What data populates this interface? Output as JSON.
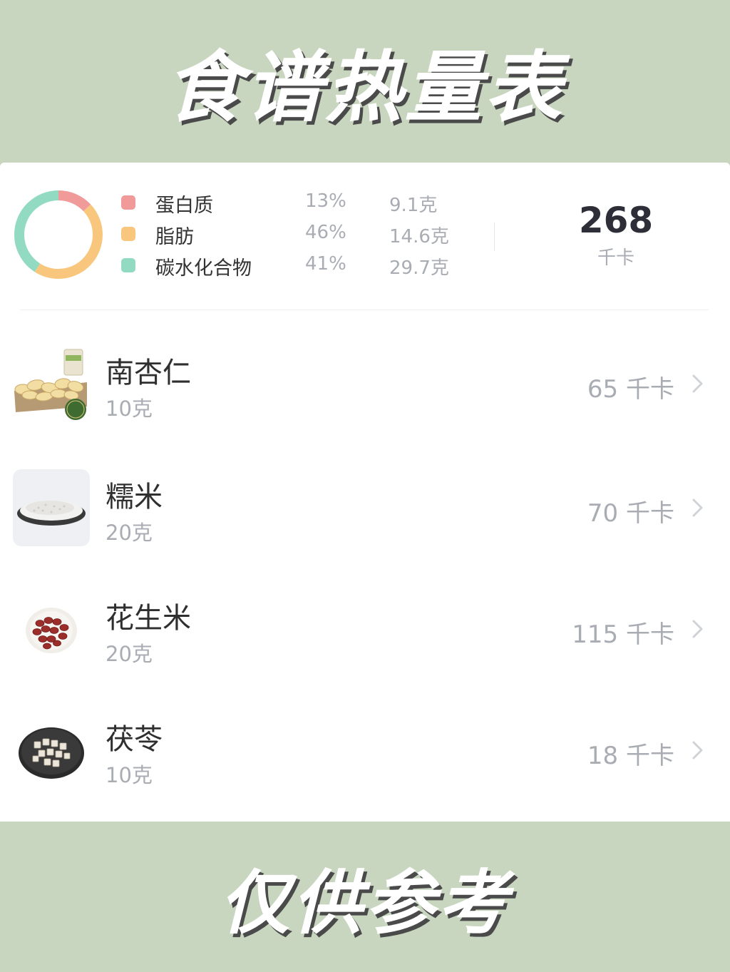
{
  "header": {
    "title": "食谱热量表"
  },
  "footer": {
    "title": "仅供参考"
  },
  "nutrition": {
    "items": [
      {
        "label": "蛋白质",
        "percent": "13%",
        "grams": "9.1克",
        "share": 0.13,
        "color": "#f19a9a"
      },
      {
        "label": "脂肪",
        "percent": "46%",
        "grams": "14.6克",
        "share": 0.46,
        "color": "#f8c77d"
      },
      {
        "label": "碳水化合物",
        "percent": "41%",
        "grams": "29.7克",
        "share": 0.41,
        "color": "#92dbc2"
      }
    ],
    "total_value": "268",
    "total_unit": "千卡"
  },
  "foods": [
    {
      "name": "南杏仁",
      "amount": "10克",
      "kcal": "65 千卡",
      "icon": "almond-photo"
    },
    {
      "name": "糯米",
      "amount": "20克",
      "kcal": "70 千卡",
      "icon": "glutinous-rice-photo"
    },
    {
      "name": "花生米",
      "amount": "20克",
      "kcal": "115 千卡",
      "icon": "peanut-photo"
    },
    {
      "name": "茯苓",
      "amount": "10克",
      "kcal": "18 千卡",
      "icon": "poria-photo"
    }
  ],
  "colors": {
    "background": "#c8d6c0",
    "card": "#ffffff",
    "muted_text": "#a9adb3"
  }
}
